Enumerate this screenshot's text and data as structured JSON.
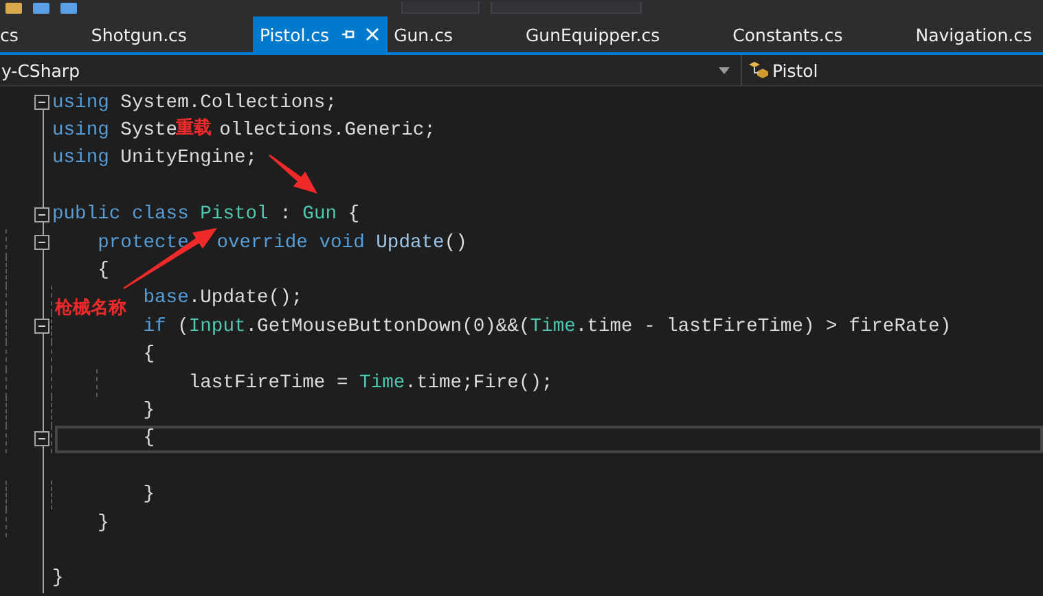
{
  "tabs": [
    {
      "label": "cs",
      "selected": false
    },
    {
      "label": "Shotgun.cs",
      "selected": false
    },
    {
      "label": "Pistol.cs",
      "selected": true
    },
    {
      "label": "Gun.cs",
      "selected": false
    },
    {
      "label": "GunEquipper.cs",
      "selected": false
    },
    {
      "label": "Constants.cs",
      "selected": false
    },
    {
      "label": "Navigation.cs",
      "selected": false
    }
  ],
  "nav_bar": {
    "project": "y-CSharp",
    "member": "Pistol"
  },
  "code_lines": [
    {
      "fold": true,
      "current": false,
      "tokens": [
        {
          "kind": "keyword",
          "text": "using"
        },
        {
          "kind": "plain",
          "text": " System.Collections;"
        }
      ]
    },
    {
      "fold": false,
      "current": false,
      "tokens": [
        {
          "kind": "keyword",
          "text": "using"
        },
        {
          "kind": "plain",
          "text": " Syste"
        },
        {
          "kind": "gap"
        },
        {
          "kind": "plain",
          "text": "ollections.Generic;"
        }
      ]
    },
    {
      "fold": false,
      "current": false,
      "tokens": [
        {
          "kind": "keyword",
          "text": "using"
        },
        {
          "kind": "plain",
          "text": " UnityEngine;"
        }
      ]
    },
    {
      "fold": false,
      "current": false
    },
    {
      "fold": true,
      "current": false,
      "tokens": [
        {
          "kind": "keyword",
          "text": "public"
        },
        {
          "kind": "keyword",
          "text": " class"
        },
        {
          "kind": "type",
          "text": " Pistol"
        },
        {
          "kind": "plain",
          "text": " :"
        },
        {
          "kind": "type",
          "text": " Gun"
        },
        {
          "kind": "plain",
          "text": " {"
        }
      ]
    },
    {
      "fold": true,
      "current": false,
      "tokens": [
        {
          "kind": "keyword",
          "text": "    protecte"
        },
        {
          "kind": "gap"
        },
        {
          "kind": "keyword",
          "text": "override"
        },
        {
          "kind": "keyword",
          "text": " void"
        },
        {
          "kind": "method",
          "text": " Update"
        },
        {
          "kind": "plain",
          "text": "()"
        }
      ]
    },
    {
      "fold": false,
      "current": false,
      "tokens": [
        {
          "kind": "plain",
          "text": "    {"
        }
      ]
    },
    {
      "fold": false,
      "current": false,
      "tokens": [
        {
          "kind": "keyword",
          "text": "        base"
        },
        {
          "kind": "plain",
          "text": ".Update();"
        }
      ]
    },
    {
      "fold": true,
      "current": false,
      "tokens": [
        {
          "kind": "keyword",
          "text": "        if"
        },
        {
          "kind": "plain",
          "text": " ("
        },
        {
          "kind": "type",
          "text": "Input"
        },
        {
          "kind": "plain",
          "text": ".GetMouseButtonDown(0)&&("
        },
        {
          "kind": "type",
          "text": "Time"
        },
        {
          "kind": "plain",
          "text": ".time - lastFireTime) > fireRate)"
        }
      ]
    },
    {
      "fold": false,
      "current": false,
      "tokens": [
        {
          "kind": "plain",
          "text": "        {"
        }
      ]
    },
    {
      "fold": false,
      "current": false,
      "tokens": [
        {
          "kind": "plain",
          "text": "            lastFireTime = "
        },
        {
          "kind": "type",
          "text": "Time"
        },
        {
          "kind": "plain",
          "text": ".time;Fire();"
        }
      ]
    },
    {
      "fold": false,
      "current": false,
      "tokens": [
        {
          "kind": "plain",
          "text": "        }"
        }
      ]
    },
    {
      "fold": true,
      "current": true,
      "tokens": [
        {
          "kind": "plain",
          "text": "        {"
        }
      ]
    },
    {
      "fold": false,
      "current": false
    },
    {
      "fold": false,
      "current": false,
      "tokens": [
        {
          "kind": "plain",
          "text": "        }"
        }
      ]
    },
    {
      "fold": false,
      "current": false,
      "tokens": [
        {
          "kind": "plain",
          "text": "    }"
        }
      ]
    },
    {
      "fold": false,
      "current": false
    },
    {
      "fold": false,
      "current": false,
      "tokens": [
        {
          "kind": "plain",
          "text": "}"
        }
      ]
    }
  ],
  "annotations": [
    {
      "text": "重载"
    },
    {
      "text": "枪械名称"
    }
  ]
}
